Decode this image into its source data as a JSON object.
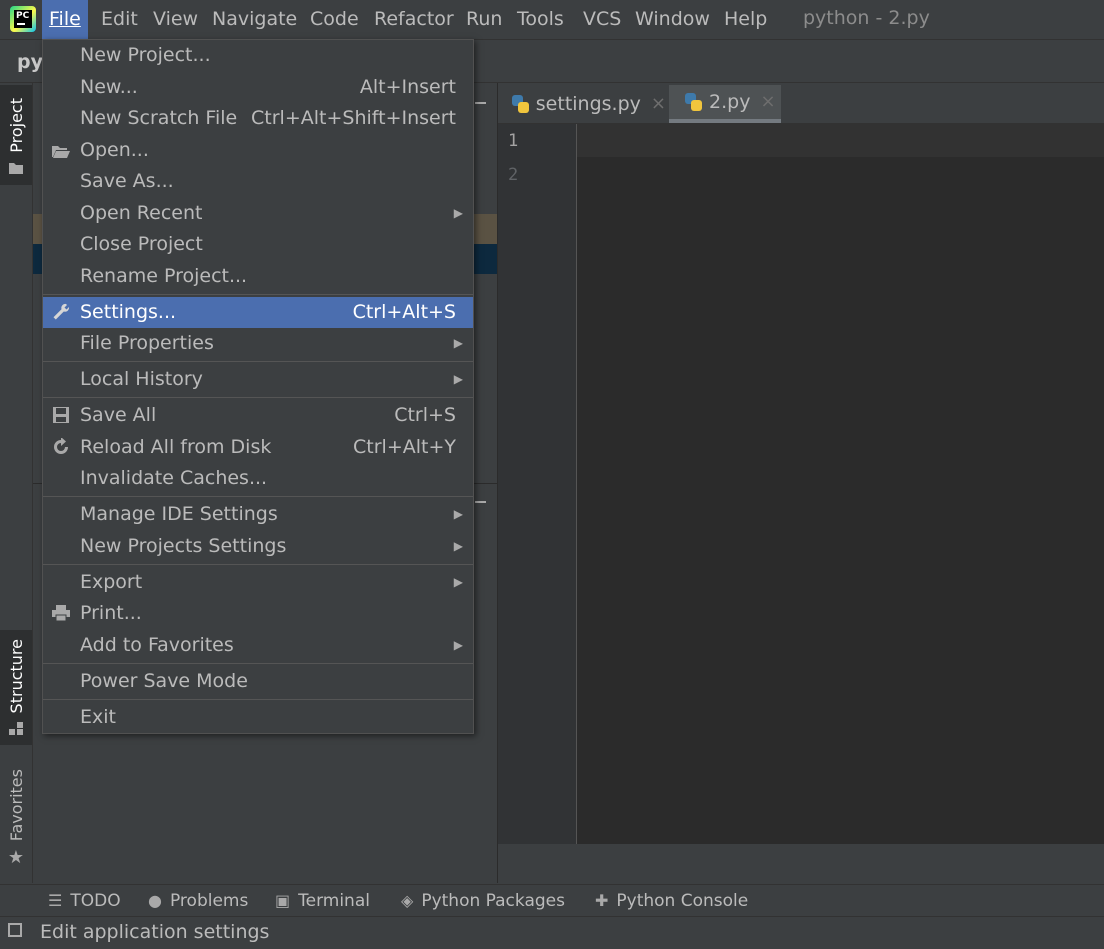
{
  "menubar": {
    "items": [
      {
        "label": "File"
      },
      {
        "label": "Edit"
      },
      {
        "label": "View"
      },
      {
        "label": "Navigate"
      },
      {
        "label": "Code"
      },
      {
        "label": "Refactor"
      },
      {
        "label": "Run"
      },
      {
        "label": "Tools"
      },
      {
        "label": "VCS"
      },
      {
        "label": "Window"
      },
      {
        "label": "Help"
      }
    ],
    "window_title": "python - 2.py",
    "logo_text": "PC"
  },
  "toolbar": {
    "project_crumb": "py"
  },
  "left_strip": {
    "project_label": "Project",
    "structure_label": "Structure",
    "favorites_label": "Favorites"
  },
  "editor": {
    "tabs": [
      {
        "label": "settings.py",
        "close": "×"
      },
      {
        "label": "2.py",
        "close": "×"
      }
    ],
    "line_numbers": [
      "1",
      "2"
    ]
  },
  "file_menu": {
    "items": [
      {
        "label": "New Project...",
        "shortcut": ""
      },
      {
        "label": "New...",
        "shortcut": "Alt+Insert"
      },
      {
        "label": "New Scratch File",
        "shortcut": "Ctrl+Alt+Shift+Insert"
      },
      {
        "label": "Open...",
        "shortcut": ""
      },
      {
        "label": "Save As...",
        "shortcut": ""
      },
      {
        "label": "Open Recent",
        "shortcut": ""
      },
      {
        "label": "Close Project",
        "shortcut": ""
      },
      {
        "label": "Rename Project...",
        "shortcut": ""
      },
      {
        "label": "Settings...",
        "shortcut": "Ctrl+Alt+S"
      },
      {
        "label": "File Properties",
        "shortcut": ""
      },
      {
        "label": "Local History",
        "shortcut": ""
      },
      {
        "label": "Save All",
        "shortcut": "Ctrl+S"
      },
      {
        "label": "Reload All from Disk",
        "shortcut": "Ctrl+Alt+Y"
      },
      {
        "label": "Invalidate Caches...",
        "shortcut": ""
      },
      {
        "label": "Manage IDE Settings",
        "shortcut": ""
      },
      {
        "label": "New Projects Settings",
        "shortcut": ""
      },
      {
        "label": "Export",
        "shortcut": ""
      },
      {
        "label": "Print...",
        "shortcut": ""
      },
      {
        "label": "Add to Favorites",
        "shortcut": ""
      },
      {
        "label": "Power Save Mode",
        "shortcut": ""
      },
      {
        "label": "Exit",
        "shortcut": ""
      }
    ],
    "highlighted_item": "Settings..."
  },
  "bottom_bar": {
    "tabs": [
      {
        "label": "TODO",
        "icon": "list-icon"
      },
      {
        "label": "Problems",
        "icon": "problems-icon"
      },
      {
        "label": "Terminal",
        "icon": "terminal-icon"
      },
      {
        "label": "Python Packages",
        "icon": "packages-icon"
      },
      {
        "label": "Python Console",
        "icon": "python-console-icon"
      }
    ]
  },
  "status_bar": {
    "text": "Edit application settings"
  },
  "colors": {
    "background": "#3c3f41",
    "editor": "#2b2b2b",
    "selection": "#4b6eaf"
  }
}
